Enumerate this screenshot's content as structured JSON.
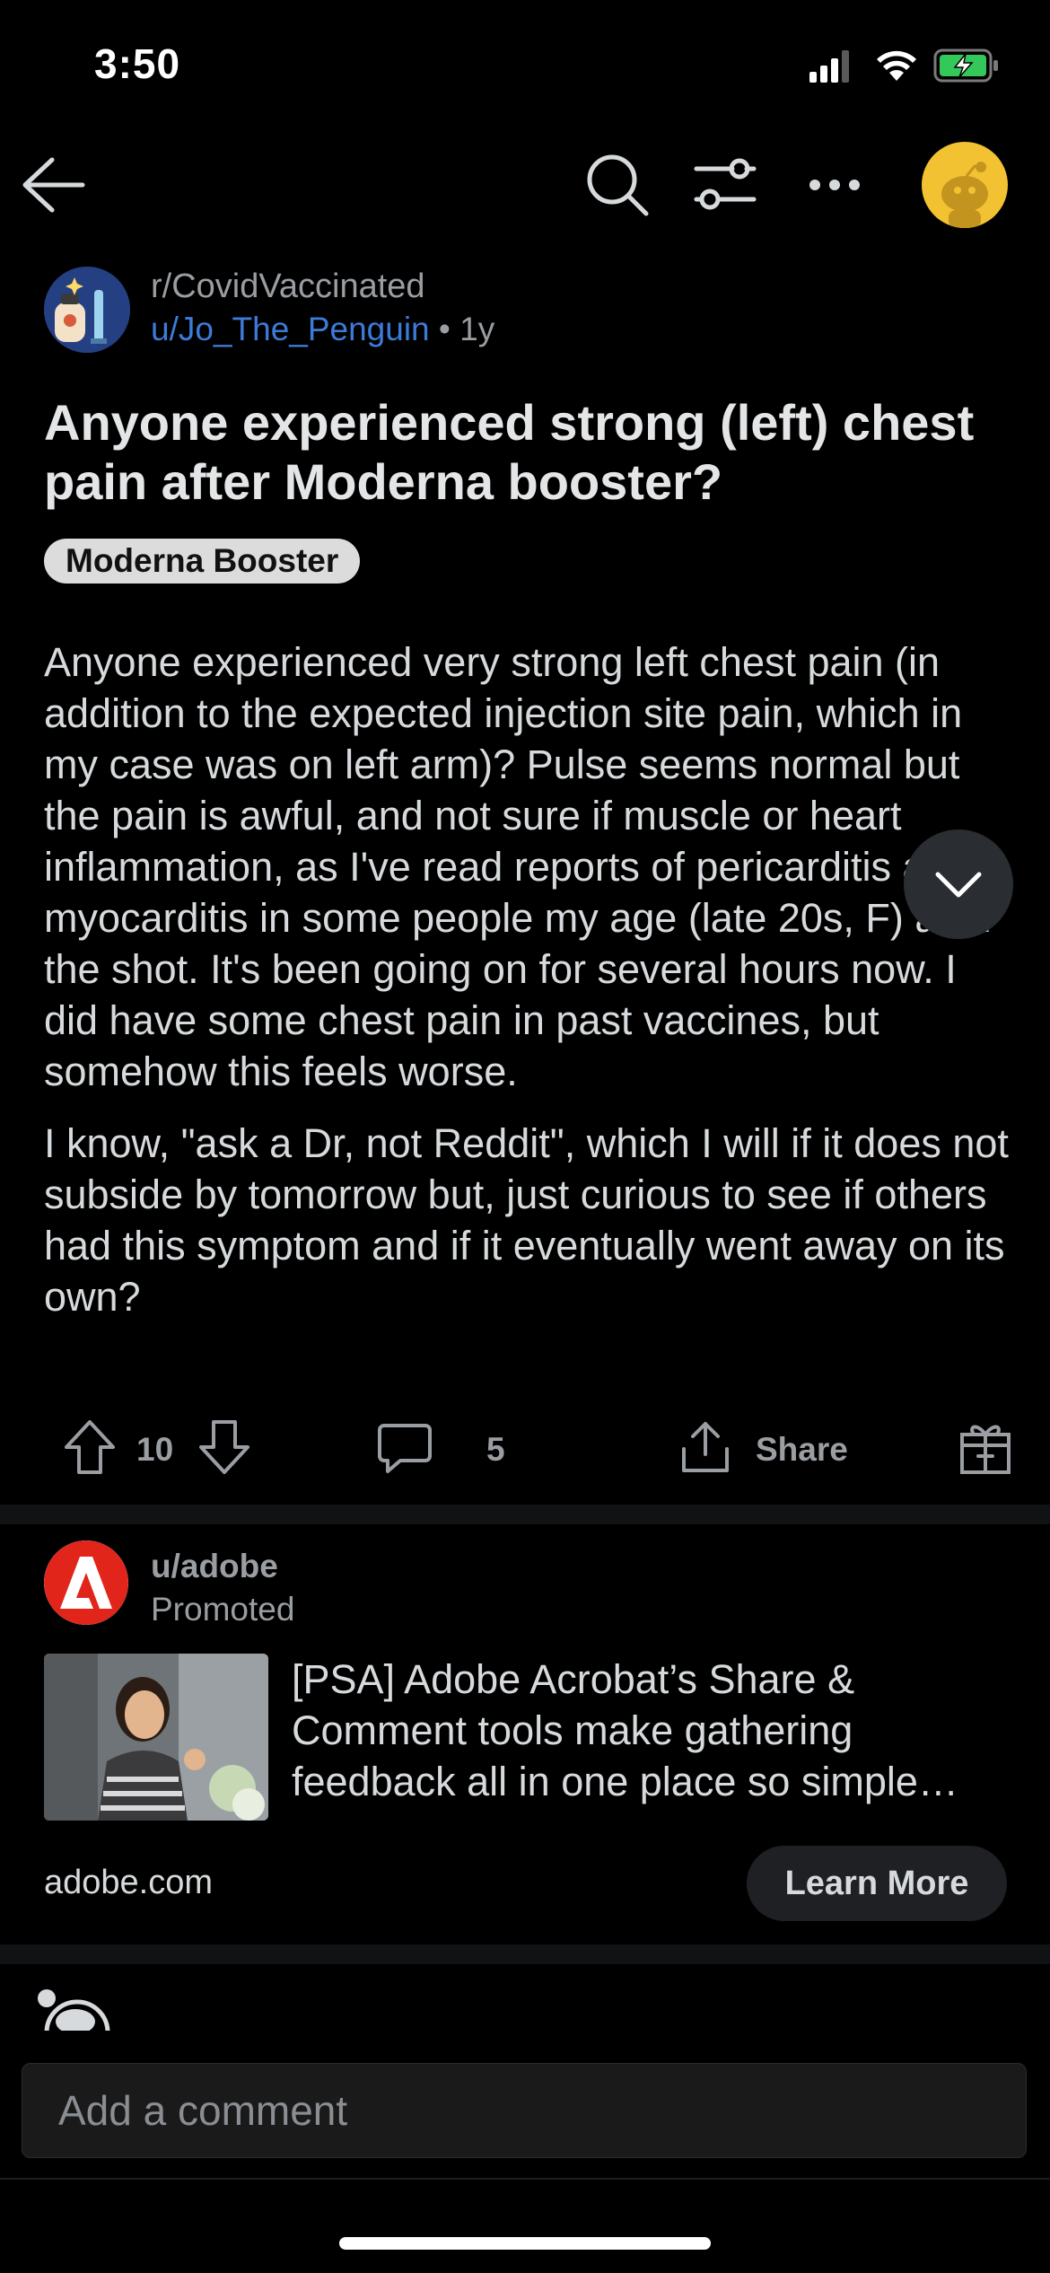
{
  "status_bar": {
    "time": "3:50",
    "icons": [
      "cellular-icon",
      "wifi-icon",
      "battery-charging-icon"
    ]
  },
  "top_bar": {
    "icons": [
      "back-arrow-icon",
      "search-icon",
      "filter-icon",
      "more-icon",
      "user-avatar"
    ]
  },
  "post": {
    "subreddit": "r/CovidVaccinated",
    "author": "u/Jo_The_Penguin",
    "separator": "•",
    "age": "1y",
    "title": "Anyone experienced strong (left) chest pain after Moderna booster?",
    "flair": "Moderna Booster",
    "body": [
      "Anyone experienced very strong left chest pain (in addition to the expected injection site pain, which in my case was on left arm)? Pulse seems normal but the pain is awful, and not sure if muscle or heart inflammation, as I've read reports of pericarditis and myocarditis in some people my age (late 20s, F) after the shot. It's been going on for several hours now. I did have some chest pain in past vaccines, but somehow this feels worse.",
      "I know, \"ask a Dr, not Reddit\", which I will if it does not subside by tomorrow but, just curious to see if others had this symptom and if it eventually went away on its own?"
    ],
    "votes": "10",
    "comments": "5",
    "share_label": "Share"
  },
  "ad": {
    "user": "u/adobe",
    "promoted_label": "Promoted",
    "text": "[PSA] Adobe Acrobat’s Share & Comment tools make gathering feedback all in one place so simple…",
    "domain": "adobe.com",
    "cta": "Learn More"
  },
  "comment_input": {
    "placeholder": "Add a comment"
  },
  "colors": {
    "background": "#000000",
    "link_blue": "#3d7bd9",
    "flair_bg": "#dcdcdc",
    "avatar_yellow": "#f2c233",
    "adobe_red": "#e1251b"
  }
}
